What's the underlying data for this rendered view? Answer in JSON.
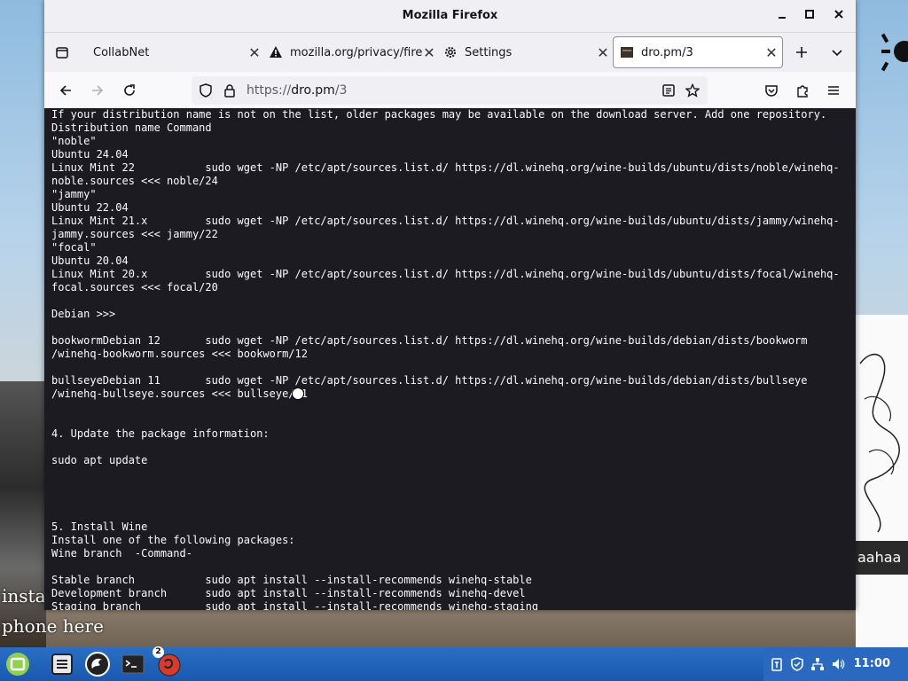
{
  "window": {
    "title": "Mozilla Firefox",
    "minimize_glyph": "✕"
  },
  "tabs": [
    {
      "label": "CollabNet",
      "icon": "page-icon",
      "active": false
    },
    {
      "label": "mozilla.org/privacy/fire",
      "icon": "warning-icon",
      "active": false
    },
    {
      "label": "Settings",
      "icon": "gear-icon",
      "active": false
    },
    {
      "label": "dro.pm/3",
      "icon": "site-favicon",
      "active": true
    }
  ],
  "address_bar": {
    "url_scheme": "https://",
    "url_host": "dro.pm",
    "url_path": "/3"
  },
  "page": {
    "lines": [
      "If your distribution name is not on the list, older packages may be available on the download server. Add one repository.",
      "Distribution name Command",
      "\"noble\"",
      "Ubuntu 24.04",
      "Linux Mint 22           sudo wget -NP /etc/apt/sources.list.d/ https://dl.winehq.org/wine-builds/ubuntu/dists/noble/winehq-",
      "noble.sources <<< noble/24",
      "\"jammy\"",
      "Ubuntu 22.04",
      "Linux Mint 21.x         sudo wget -NP /etc/apt/sources.list.d/ https://dl.winehq.org/wine-builds/ubuntu/dists/jammy/winehq-",
      "jammy.sources <<< jammy/22",
      "\"focal\"",
      "Ubuntu 20.04",
      "Linux Mint 20.x         sudo wget -NP /etc/apt/sources.list.d/ https://dl.winehq.org/wine-builds/ubuntu/dists/focal/winehq-",
      "focal.sources <<< focal/20",
      "",
      "Debian >>>",
      "",
      "bookwormDebian 12       sudo wget -NP /etc/apt/sources.list.d/ https://dl.winehq.org/wine-builds/debian/dists/bookworm",
      "/winehq-bookworm.sources <<< bookworm/12",
      "",
      "bullseyeDebian 11       sudo wget -NP /etc/apt/sources.list.d/ https://dl.winehq.org/wine-builds/debian/dists/bullseye",
      "/winehq-bullseye.sources <<< bullseye/11",
      "",
      "",
      "4. Update the package information:",
      "",
      "sudo apt update",
      "",
      "",
      "",
      "",
      "5. Install Wine",
      "Install one of the following packages:",
      "Wine branch  -Command-",
      "",
      "Stable branch           sudo apt install --install-recommends winehq-stable",
      "Development branch      sudo apt install --install-recommends winehq-devel",
      "Staging branch          sudo apt install --install-recommends winehq-staging"
    ]
  },
  "desktop": {
    "left_wallpaper_text": "install\nphone here",
    "right_wallpaper_text": "aahaa"
  },
  "taskbar": {
    "items": [
      "mint-menu-icon",
      "files-icon",
      "firefox-icon",
      "terminal-icon",
      "update-manager-icon"
    ],
    "update_badge": "2",
    "clock": "11:00"
  }
}
